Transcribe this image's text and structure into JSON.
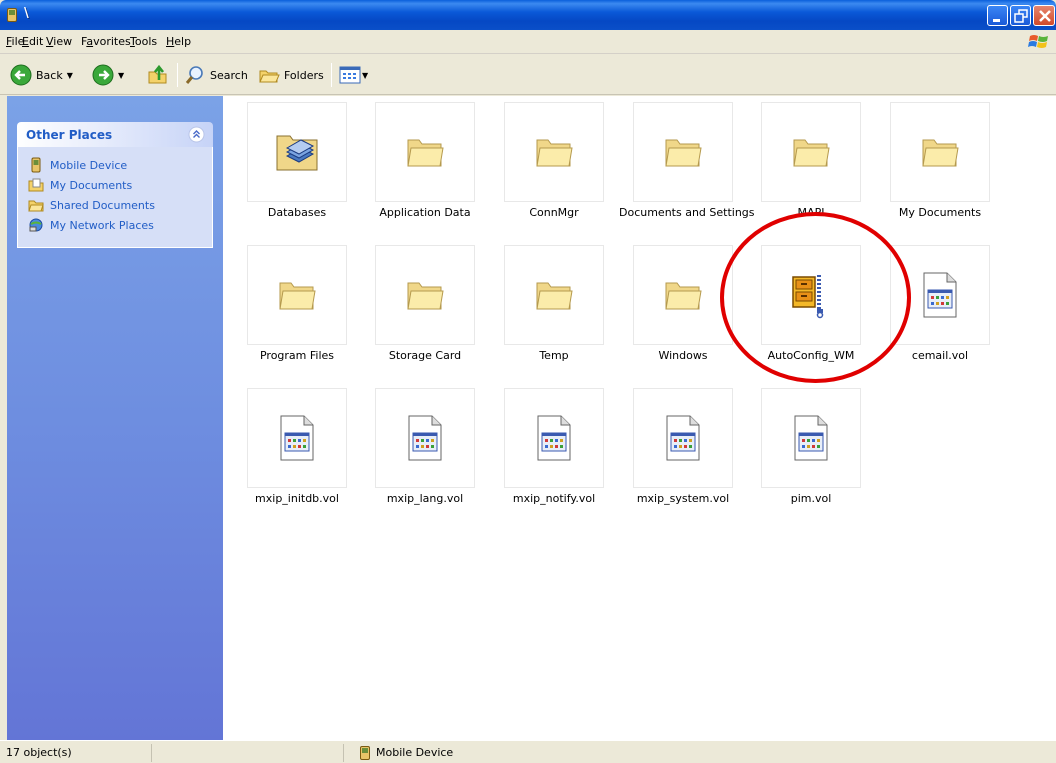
{
  "window": {
    "title": "\\"
  },
  "menu": [
    {
      "pre": "",
      "u": "F",
      "post": "ile"
    },
    {
      "pre": "",
      "u": "E",
      "post": "dit"
    },
    {
      "pre": "",
      "u": "V",
      "post": "iew"
    },
    {
      "pre": "F",
      "u": "a",
      "post": "vorites"
    },
    {
      "pre": "",
      "u": "T",
      "post": "ools"
    },
    {
      "pre": "",
      "u": "H",
      "post": "elp"
    }
  ],
  "toolbar": {
    "back_label": "Back",
    "search_label": "Search",
    "folders_label": "Folders"
  },
  "other_places": {
    "title": "Other Places",
    "links": [
      {
        "label": "Mobile Device",
        "icon": "mobile-device-icon"
      },
      {
        "label": "My Documents",
        "icon": "my-documents-icon"
      },
      {
        "label": "Shared Documents",
        "icon": "shared-documents-icon"
      },
      {
        "label": "My Network Places",
        "icon": "network-places-icon"
      }
    ]
  },
  "items": [
    {
      "label": "Databases",
      "kind": "database"
    },
    {
      "label": "Application Data",
      "kind": "folder"
    },
    {
      "label": "ConnMgr",
      "kind": "folder"
    },
    {
      "label": "Documents and Settings",
      "kind": "folder"
    },
    {
      "label": "MAPI",
      "kind": "folder"
    },
    {
      "label": "My Documents",
      "kind": "folder"
    },
    {
      "label": "Program Files",
      "kind": "folder"
    },
    {
      "label": "Storage Card",
      "kind": "folder"
    },
    {
      "label": "Temp",
      "kind": "folder"
    },
    {
      "label": "Windows",
      "kind": "folder"
    },
    {
      "label": "AutoConfig_WM",
      "kind": "cab"
    },
    {
      "label": "cemail.vol",
      "kind": "vol"
    },
    {
      "label": "mxip_initdb.vol",
      "kind": "vol"
    },
    {
      "label": "mxip_lang.vol",
      "kind": "vol"
    },
    {
      "label": "mxip_notify.vol",
      "kind": "vol"
    },
    {
      "label": "mxip_system.vol",
      "kind": "vol"
    },
    {
      "label": "pim.vol",
      "kind": "vol"
    }
  ],
  "status": {
    "count": "17 object(s)",
    "location": "Mobile Device"
  },
  "colors": {
    "titlebar": "#0a59d8",
    "sidebar": "#6e8ee0",
    "link": "#215dc6",
    "highlight": "#e00000"
  }
}
